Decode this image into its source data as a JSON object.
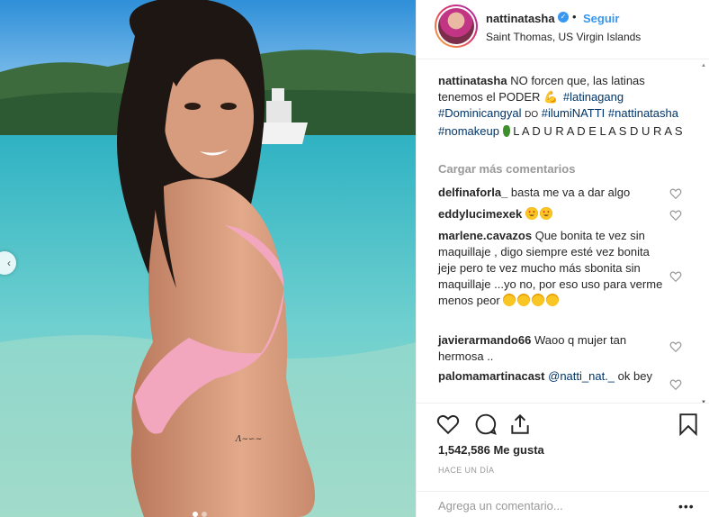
{
  "post": {
    "username": "nattinatasha",
    "follow_label": "Seguir",
    "location": "Saint Thomas, US Virgin Islands",
    "separator": "•"
  },
  "caption": {
    "username": "nattinatasha",
    "text_1": "NO forcen que, las latinas tenemos el PODER",
    "emoji_1": "💪",
    "tag_1": "#latinagang",
    "tag_2": "#Dominicangyal",
    "text_2": "DO",
    "tag_3": "#ilumiNATTI",
    "tag_4": "#nattinatasha",
    "tag_5": "#nomakeup",
    "text_3": "L A D U R A D E L A S D U R A S"
  },
  "load_more": "Cargar más comentarios",
  "comments": [
    {
      "user": "delfinaforla_",
      "text": "basta me va a dar algo"
    },
    {
      "user": "eddylucimexek",
      "text": ""
    },
    {
      "user": "marlene.cavazos",
      "text": "Que bonita te vez sin maquillaje , digo siempre esté vez bonita jeje pero te vez mucho más sbonita sin maquillaje ...yo no, por eso uso para verme menos peor"
    },
    {
      "user": "javierarmando66",
      "text": "Waoo q mujer tan hermosa .."
    },
    {
      "user": "palomamartinacast",
      "mention": "@natti_nat._",
      "text": "ok bey"
    }
  ],
  "likes_text": "1,542,586 Me gusta",
  "timestamp": "HACE UN DÍA",
  "comment_box": {
    "placeholder": "Agrega un comentario..."
  },
  "options_label": "•••",
  "colors": {
    "link": "#003569",
    "follow": "#3897f0",
    "muted": "#999999"
  },
  "icons": [
    "like-icon",
    "comment-icon",
    "share-icon",
    "bookmark-icon",
    "verified-icon",
    "prev-arrow-icon"
  ],
  "carousel": {
    "pages": 2,
    "current": 1
  }
}
